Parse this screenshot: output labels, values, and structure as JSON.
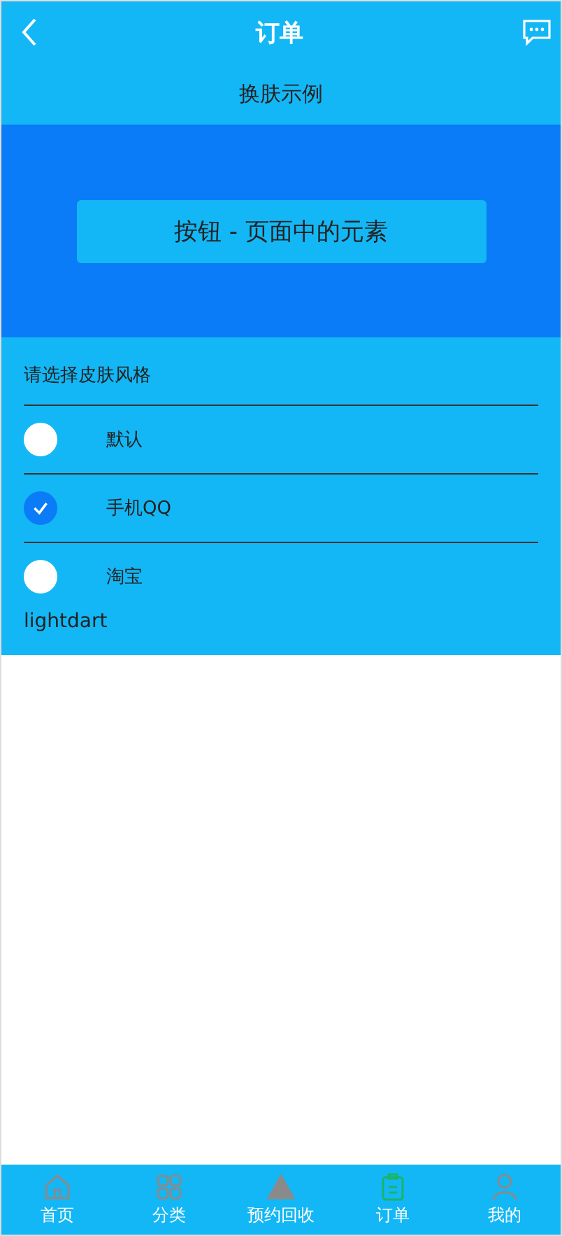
{
  "header": {
    "title": "订单"
  },
  "subtitle": "换肤示例",
  "demo_button": {
    "label": "按钮 - 页面中的元素"
  },
  "skin_section": {
    "prompt": "请选择皮肤风格",
    "options": [
      {
        "label": "默认",
        "selected": false
      },
      {
        "label": "手机QQ",
        "selected": true
      },
      {
        "label": "淘宝",
        "selected": false
      }
    ],
    "current": "lightdart"
  },
  "tab_bar": [
    {
      "label": "首页",
      "kind": "home",
      "selected": false
    },
    {
      "label": "分类",
      "kind": "grid",
      "selected": false
    },
    {
      "label": "预约回收",
      "kind": "triangle",
      "selected": false
    },
    {
      "label": "订单",
      "kind": "clipboard",
      "selected": true
    },
    {
      "label": "我的",
      "kind": "person",
      "selected": false
    }
  ]
}
